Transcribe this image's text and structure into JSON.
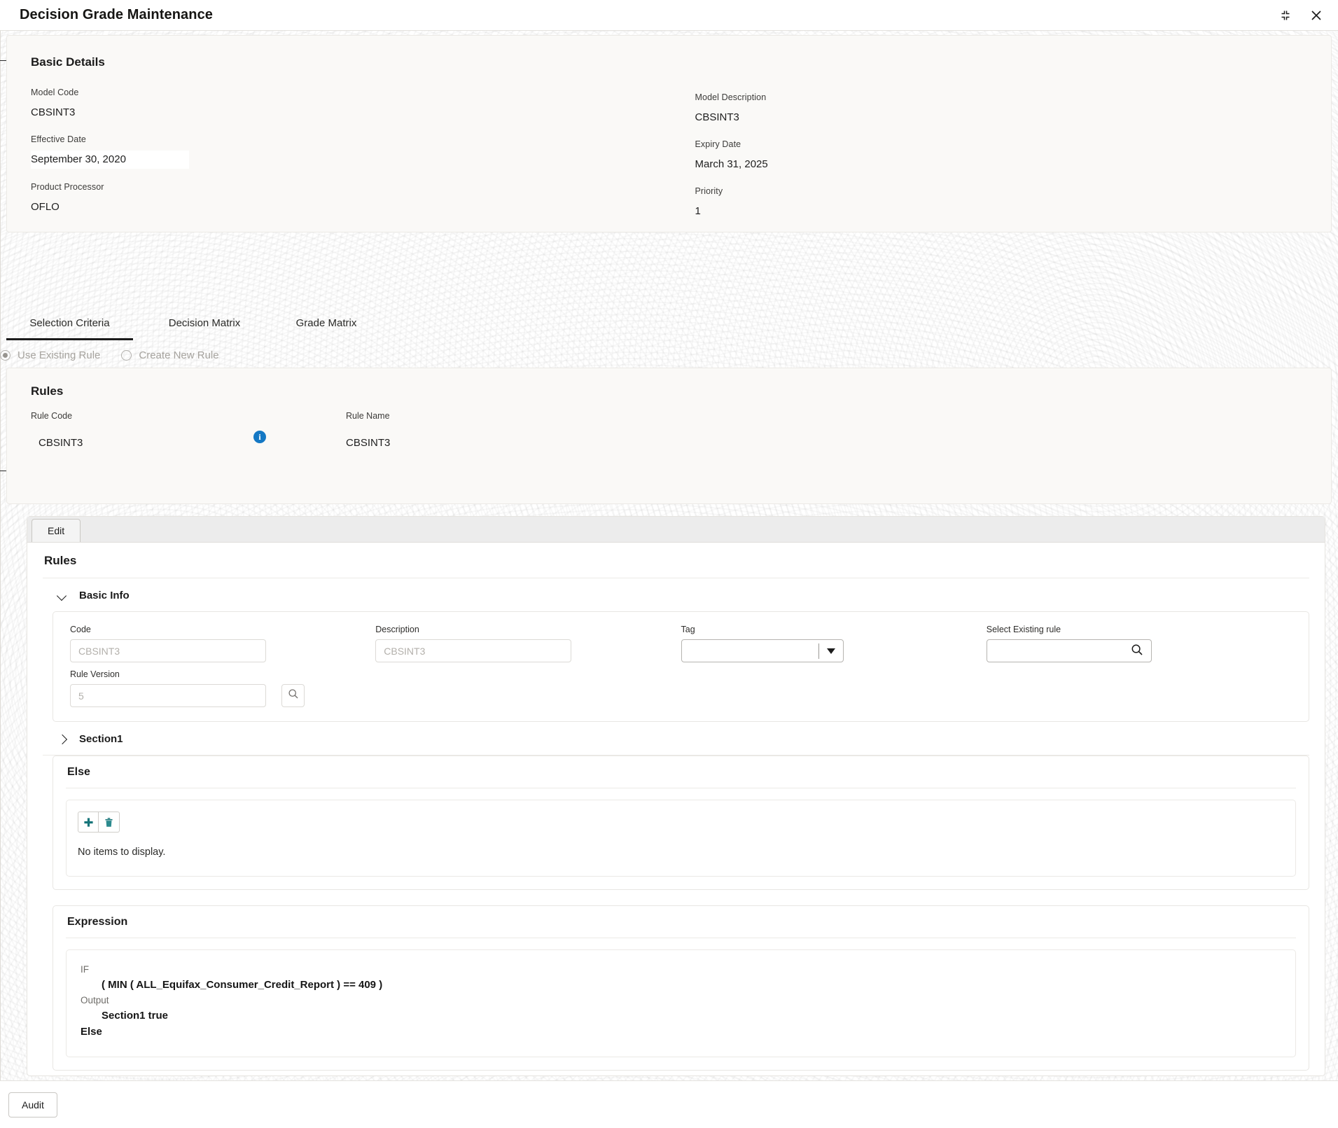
{
  "window": {
    "title": "Decision Grade Maintenance",
    "minimize_icon": "collapse-icon",
    "close_icon": "close-icon"
  },
  "basic_details": {
    "heading": "Basic Details",
    "left": [
      {
        "label": "Model Code",
        "value": "CBSINT3",
        "highlighted": false
      },
      {
        "label": "Effective Date",
        "value": "September 30, 2020",
        "highlighted": true
      },
      {
        "label": "Product Processor",
        "value": "OFLO",
        "highlighted": false
      }
    ],
    "right": [
      {
        "label": "Model Description",
        "value": "CBSINT3"
      },
      {
        "label": "Expiry Date",
        "value": "March 31, 2025"
      },
      {
        "label": "Priority",
        "value": "1"
      }
    ]
  },
  "tabs": [
    {
      "label": "Selection Criteria",
      "active": true
    },
    {
      "label": "Decision Matrix",
      "active": false
    },
    {
      "label": "Grade Matrix",
      "active": false
    }
  ],
  "rule_mode": {
    "options": [
      {
        "label": "Use Existing Rule",
        "selected": true
      },
      {
        "label": "Create New Rule",
        "selected": false
      }
    ]
  },
  "rules_header": {
    "heading": "Rules",
    "rule_code_label": "Rule Code",
    "rule_code_value": "CBSINT3",
    "rule_name_label": "Rule Name",
    "rule_name_value": "CBSINT3",
    "info_icon_glyph": "i"
  },
  "builder": {
    "edit_label": "Edit",
    "heading": "Rules",
    "basic_info": {
      "label": "Basic Info",
      "expanded": true,
      "code_label": "Code",
      "code_value": "CBSINT3",
      "description_label": "Description",
      "description_value": "CBSINT3",
      "tag_label": "Tag",
      "tag_value": "",
      "select_existing_label": "Select Existing rule",
      "select_existing_value": "",
      "rule_version_label": "Rule Version",
      "rule_version_value": "5"
    },
    "section1": {
      "label": "Section1",
      "expanded": false
    },
    "else_block": {
      "title": "Else",
      "add_button": "add-icon",
      "delete_button": "delete-icon",
      "empty_message": "No items to display."
    },
    "expression": {
      "title": "Expression",
      "lines": [
        {
          "text": "IF",
          "style": "keyword"
        },
        {
          "text": "( MIN ( ALL_Equifax_Consumer_Credit_Report ) == 409 )",
          "style": "indented"
        },
        {
          "text": "Output",
          "style": "keyword"
        },
        {
          "text": "Section1 true",
          "style": "indented"
        },
        {
          "text": "Else",
          "style": "plain"
        }
      ]
    }
  },
  "footer": {
    "audit_label": "Audit"
  },
  "colors": {
    "accent_teal": "#17757a",
    "info_blue": "#1478c4",
    "card_bg": "#faf9f7",
    "toolbar_bg": "#ececec"
  }
}
